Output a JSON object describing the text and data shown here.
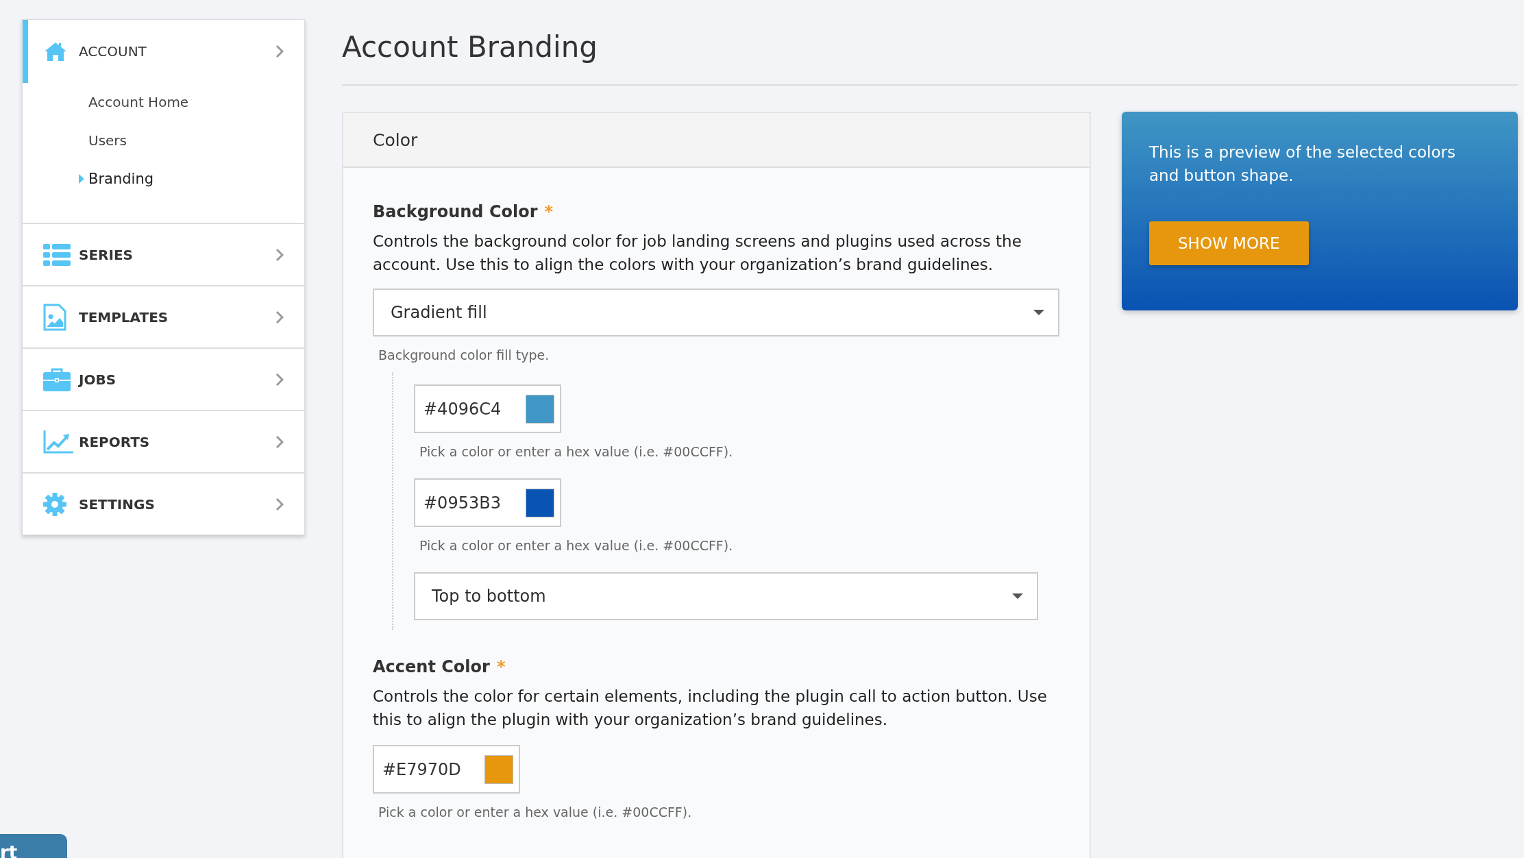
{
  "sidebar": {
    "sections": [
      {
        "label": "ACCOUNT",
        "kind": "house",
        "selected": true,
        "children": [
          {
            "label": "Account Home",
            "selected": false
          },
          {
            "label": "Users",
            "selected": false
          },
          {
            "label": "Branding",
            "selected": true
          }
        ]
      },
      {
        "label": "SERIES",
        "kind": "list",
        "selected": false
      },
      {
        "label": "TEMPLATES",
        "kind": "image",
        "selected": false
      },
      {
        "label": "JOBS",
        "kind": "briefcase",
        "selected": false
      },
      {
        "label": "REPORTS",
        "kind": "chart",
        "selected": false
      },
      {
        "label": "SETTINGS",
        "kind": "gear",
        "selected": false
      }
    ]
  },
  "page_title": "Account Branding",
  "card": {
    "title": "Color",
    "background": {
      "label": "Background Color",
      "required_mark": "*",
      "description": "Controls the background color for job landing screens and plugins used across the account. Use this to align the colors with your organization’s brand guidelines.",
      "fill_select": "Gradient fill",
      "fill_help": "Background color fill type.",
      "stops": [
        {
          "value": "#4096C4",
          "color": "#4096c4",
          "help": "Pick a color or enter a hex value (i.e. #00CCFF)."
        },
        {
          "value": "#0953B3",
          "color": "#0953b3",
          "help": "Pick a color or enter a hex value (i.e. #00CCFF)."
        }
      ],
      "direction_select": "Top to bottom"
    },
    "accent": {
      "label": "Accent Color",
      "required_mark": "*",
      "description": "Controls the color for certain elements, including the plugin call to action button. Use this to align the plugin with your organization’s brand guidelines.",
      "value": "#E7970D",
      "color": "#e7970d",
      "help": "Pick a color or enter a hex value (i.e. #00CCFF)."
    }
  },
  "preview": {
    "text": "This is a preview of the selected colors and button shape.",
    "button": "SHOW MORE"
  },
  "floating_tab": {
    "label": "rt"
  }
}
